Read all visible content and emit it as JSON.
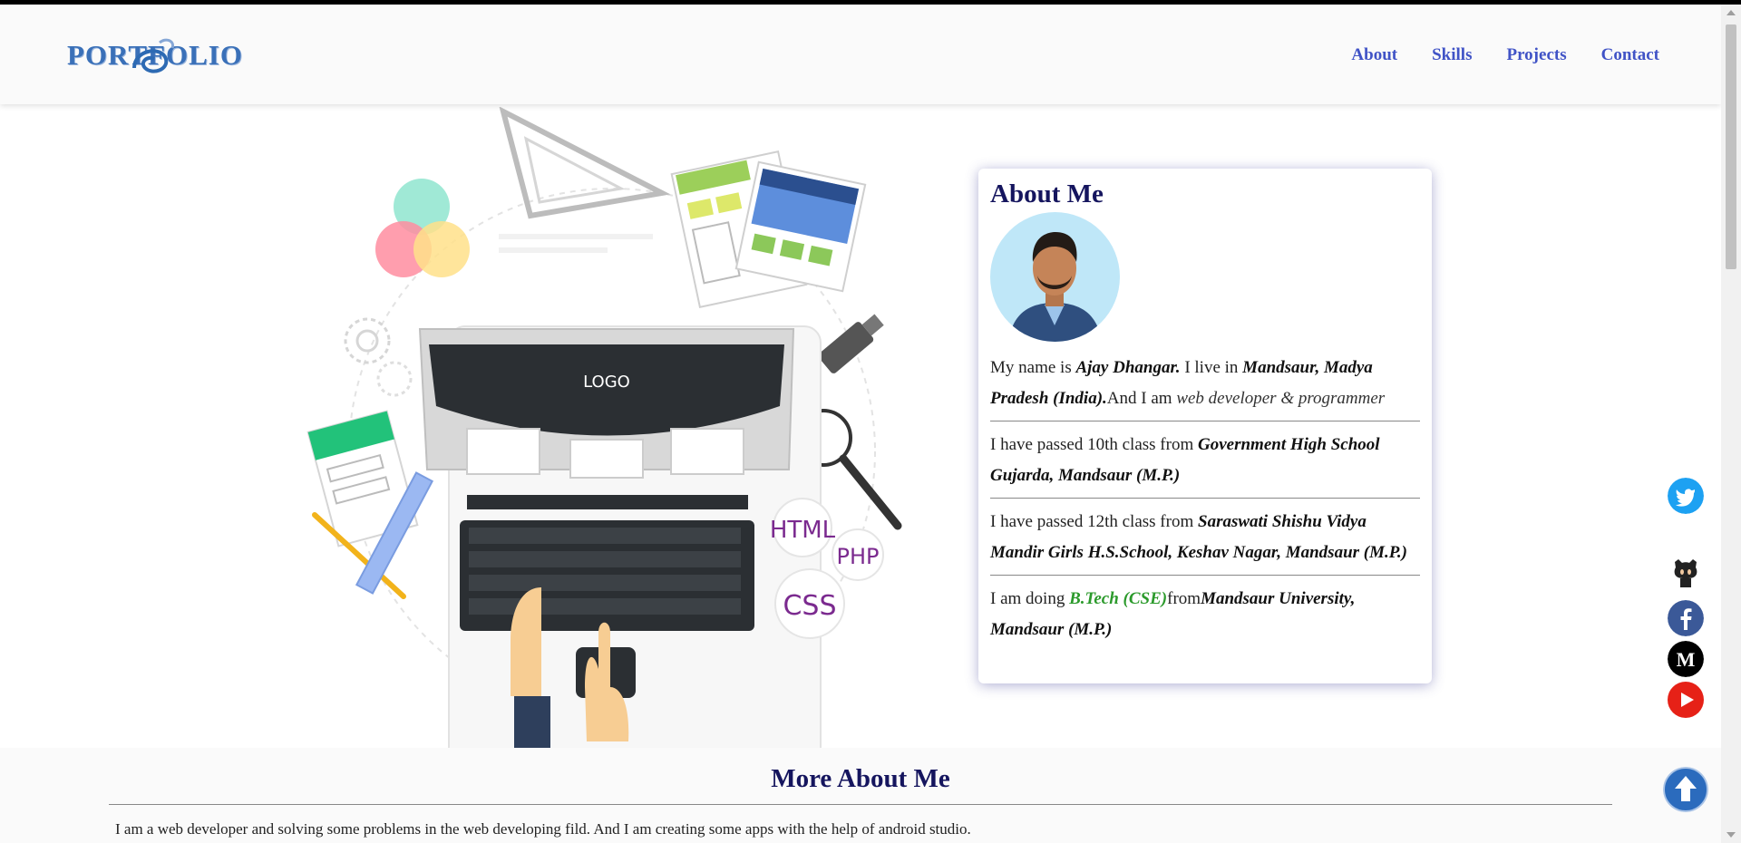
{
  "header": {
    "logo_text": "PORTFOLIO",
    "nav": [
      {
        "label": "About"
      },
      {
        "label": "Skills"
      },
      {
        "label": "Projects"
      },
      {
        "label": "Contact"
      }
    ]
  },
  "illustration": {
    "laptop_logo": "LOGO",
    "badges": [
      "HTML",
      "PHP",
      "CSS"
    ]
  },
  "about": {
    "title": "About Me",
    "p1": {
      "t1": "My name is ",
      "name": "Ajay Dhangar.",
      "t2": " I live in ",
      "place": "Mandsaur, Madya Pradesh (India).",
      "t3": "And I am ",
      "role": "web developer & programmer"
    },
    "p2": {
      "t1": "I have passed 10th class from ",
      "school": "Government High School Gujarda, Mandsaur (M.P.)"
    },
    "p3": {
      "t1": "I have passed 12th class from ",
      "school": "Saraswati Shishu Vidya Mandir Girls H.S.School, Keshav Nagar, Mandsaur (M.P.)"
    },
    "p4": {
      "t1": "I am doing ",
      "degree": "B.Tech (CSE)",
      "t2": "from",
      "university": "Mandsaur University, Mandsaur (M.P.)"
    }
  },
  "more": {
    "title": "More About Me",
    "text": "I am a web developer and solving some problems in the web developing fild. And I am creating some apps with the help of android studio."
  },
  "social": [
    "twitter-icon",
    "github-icon",
    "facebook-icon",
    "medium-icon",
    "youtube-icon"
  ],
  "colors": {
    "heading": "#15155e",
    "nav": "#4053c6",
    "degree": "#2b9a2b",
    "twitter": "#1da1f2",
    "facebook": "#3b5998",
    "youtube": "#e62117"
  }
}
